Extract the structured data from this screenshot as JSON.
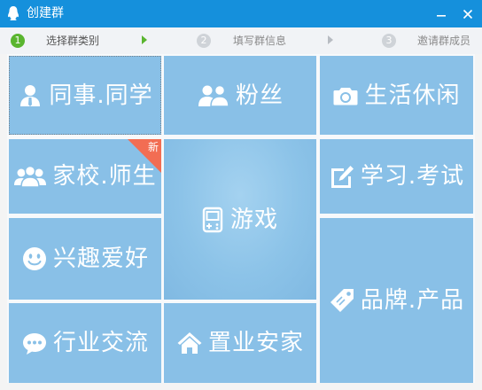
{
  "window": {
    "title": "创建群"
  },
  "steps": [
    {
      "number": "1",
      "label": "选择群类别"
    },
    {
      "number": "2",
      "label": "填写群信息"
    },
    {
      "number": "3",
      "label": "邀请群成员"
    }
  ],
  "categories": {
    "colleagues": {
      "label": "同事.同学",
      "icon": "person-icon"
    },
    "fans": {
      "label": "粉丝",
      "icon": "people-icon"
    },
    "leisure": {
      "label": "生活休闲",
      "icon": "camera-icon"
    },
    "school": {
      "label": "家校.师生",
      "icon": "group-icon",
      "badge": "新"
    },
    "game": {
      "label": "游戏",
      "icon": "gamepad-icon"
    },
    "study": {
      "label": "学习.考试",
      "icon": "edit-icon"
    },
    "hobby": {
      "label": "兴趣爱好",
      "icon": "smiley-icon"
    },
    "brand": {
      "label": "品牌.产品",
      "icon": "tag-icon"
    },
    "industry": {
      "label": "行业交流",
      "icon": "chat-bubble-icon"
    },
    "realestate": {
      "label": "置业安家",
      "icon": "home-icon"
    }
  },
  "colors": {
    "titlebar": "#1590dc",
    "tile": "#89c0e7",
    "badge": "#f26d53",
    "active_step": "#5ab52f",
    "inactive_step": "#cfd3d8"
  }
}
